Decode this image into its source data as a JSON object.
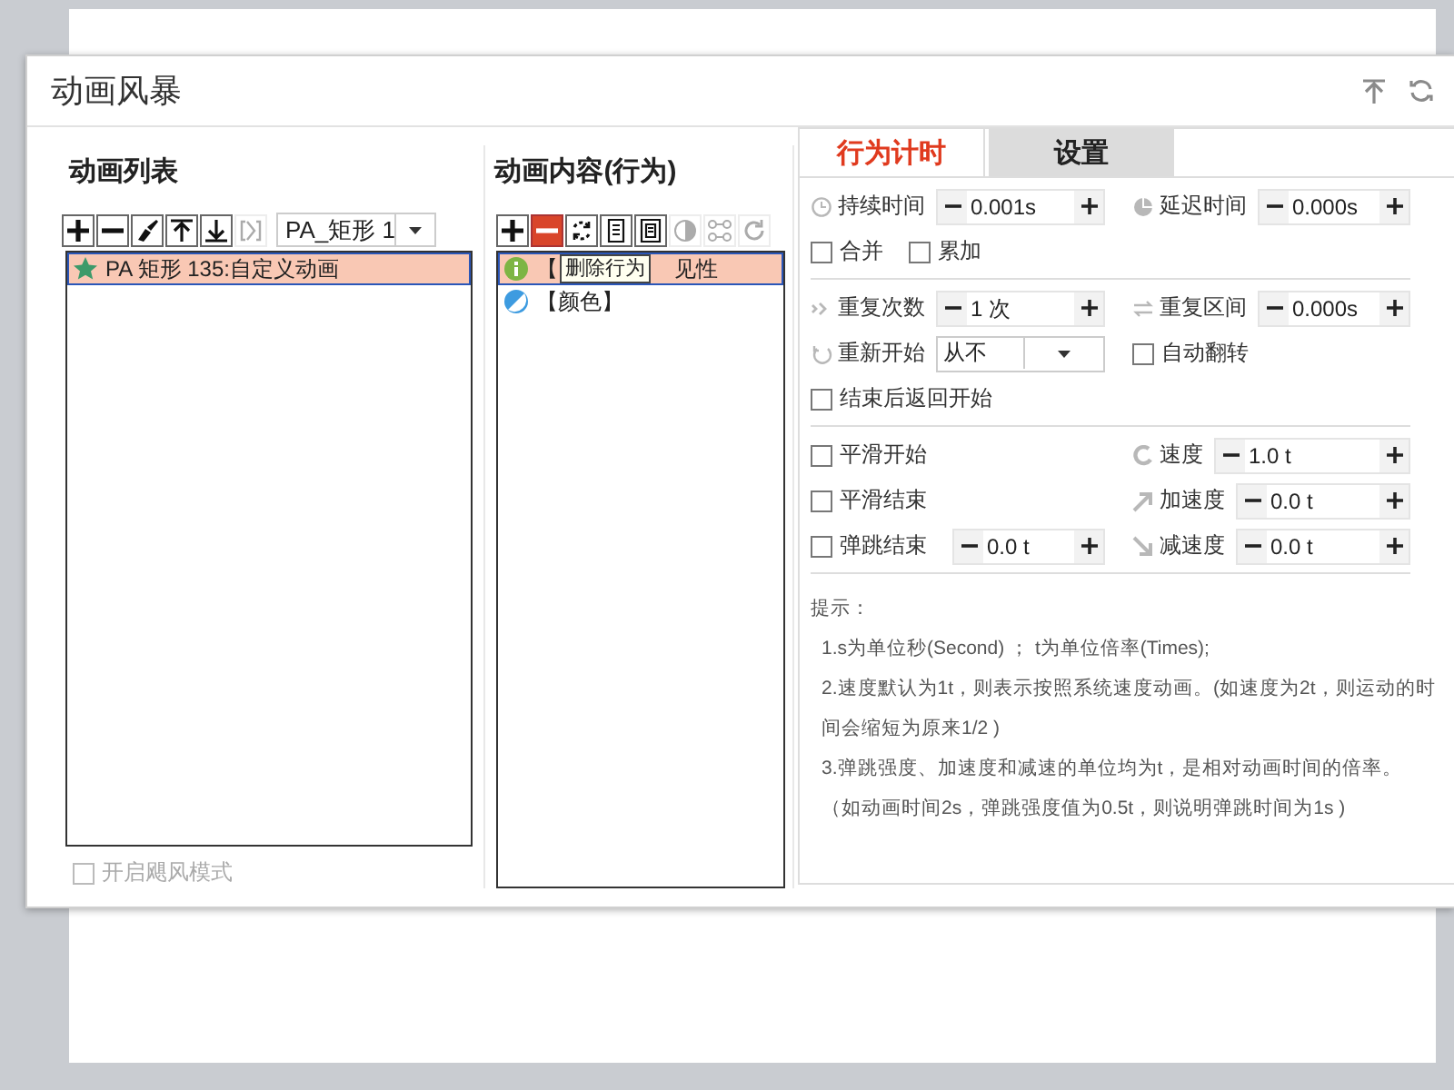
{
  "window": {
    "title": "动画风暴",
    "controls": [
      {
        "kind": "pin-top"
      },
      {
        "kind": "refresh"
      }
    ]
  },
  "animation_list": {
    "heading": "动画列表",
    "toolbar": [
      {
        "kind": "add",
        "disabled": false,
        "highlighted": false
      },
      {
        "kind": "remove",
        "disabled": false,
        "highlighted": false
      },
      {
        "kind": "brush",
        "disabled": false,
        "highlighted": false
      },
      {
        "kind": "move-top",
        "disabled": false,
        "highlighted": false
      },
      {
        "kind": "move-bottom",
        "disabled": false,
        "highlighted": false
      },
      {
        "kind": "bracket",
        "disabled": true,
        "highlighted": false
      }
    ],
    "dropdown": {
      "value": "PA_矩形 1"
    },
    "items": [
      {
        "label": "PA 矩形 135:自定义动画",
        "selected": true
      }
    ],
    "hurricane_mode": {
      "label": "开启飓风模式",
      "checked": false,
      "disabled": true
    }
  },
  "animation_content": {
    "heading": "动画内容(行为)",
    "toolbar": [
      {
        "kind": "add",
        "disabled": false,
        "highlighted": false
      },
      {
        "kind": "remove",
        "disabled": false,
        "highlighted": true
      },
      {
        "kind": "loop",
        "disabled": false,
        "highlighted": false
      },
      {
        "kind": "document",
        "disabled": false,
        "highlighted": false
      },
      {
        "kind": "document-framed",
        "disabled": false,
        "highlighted": false
      },
      {
        "kind": "contrast",
        "disabled": true,
        "highlighted": false
      },
      {
        "kind": "nodes",
        "disabled": true,
        "highlighted": false
      },
      {
        "kind": "refresh",
        "disabled": true,
        "highlighted": false
      }
    ],
    "items": [
      {
        "kind": "info",
        "label_parts": [
          "【",
          "见性"
        ],
        "selected": true
      },
      {
        "kind": "color",
        "label_parts": [
          "【颜色】"
        ],
        "selected": false
      }
    ],
    "tooltip": "删除行为"
  },
  "settings": {
    "tabs": [
      {
        "label": "行为计时",
        "selected": true
      },
      {
        "label": "设置",
        "selected": false
      }
    ],
    "groups": [
      {
        "rows": [
          {
            "left": [
              {
                "kind": "stepper",
                "label": "持续时间",
                "value": "0.001s"
              }
            ],
            "right": [
              {
                "kind": "stepper",
                "label": "延迟时间",
                "value": "0.000s"
              }
            ]
          },
          {
            "left": [
              {
                "kind": "checkbox",
                "label": "合并",
                "checked": false
              },
              {
                "kind": "checkbox",
                "label": "累加",
                "checked": false
              }
            ],
            "right": []
          }
        ]
      },
      {
        "rows": [
          {
            "left": [
              {
                "kind": "stepper",
                "label": "重复次数",
                "value": "1 次"
              }
            ],
            "right": [
              {
                "kind": "stepper",
                "label": "重复区间",
                "value": "0.000s"
              }
            ]
          },
          {
            "left": [
              {
                "kind": "dropdown",
                "label": "重新开始",
                "value": "从不"
              }
            ],
            "right": [
              {
                "kind": "checkbox",
                "label": "自动翻转",
                "checked": false
              }
            ]
          },
          {
            "left": [
              {
                "kind": "checkbox",
                "label": "结束后返回开始",
                "checked": false
              }
            ],
            "right": []
          }
        ]
      },
      {
        "rows": [
          {
            "left": [
              {
                "kind": "checkbox",
                "label": "平滑开始",
                "checked": false
              }
            ],
            "right": [
              {
                "kind": "stepper",
                "label": "速度",
                "value": "1.0 t"
              }
            ]
          },
          {
            "left": [
              {
                "kind": "checkbox",
                "label": "平滑结束",
                "checked": false
              }
            ],
            "right": [
              {
                "kind": "stepper",
                "label": "加速度",
                "value": "0.0 t"
              }
            ]
          },
          {
            "left": [
              {
                "kind": "checkbox",
                "label": "弹跳结束",
                "checked": false
              },
              {
                "kind": "stepper",
                "value": "0.0 t"
              }
            ],
            "right": [
              {
                "kind": "stepper",
                "label": "减速度",
                "value": "0.0 t"
              }
            ]
          }
        ]
      }
    ],
    "hints": {
      "title": "提示：",
      "lines": [
        "1.s为单位秒(Second) ； t为单位倍率(Times);",
        "2.速度默认为1t，则表示按照系统速度动画。(如速度为2t，则运动的时间会缩短为原来1/2 )",
        "3.弹跳强度、加速度和减速的单位均为t，是相对动画时间的倍率。（如动画时间2s，弹跳强度值为0.5t，则说明弹跳时间为1s )"
      ]
    }
  }
}
